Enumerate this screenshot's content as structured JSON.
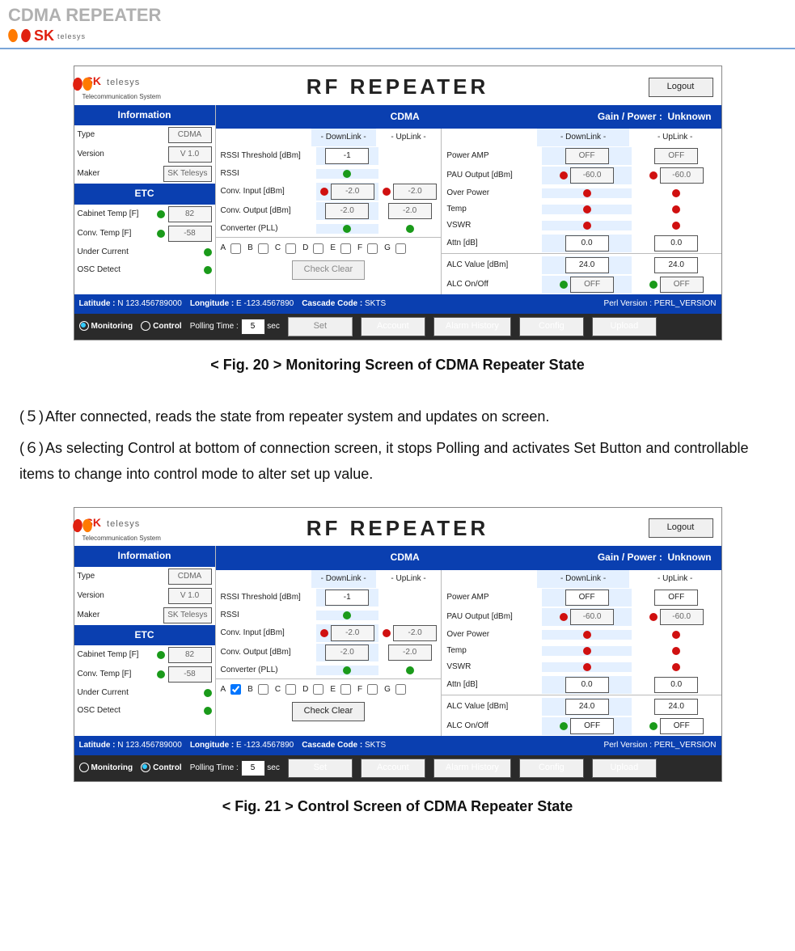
{
  "page_header": "CDMA REPEATER",
  "brand": {
    "name": "SK",
    "sub": "telesys",
    "tagline": "Telecommunication System"
  },
  "caption1": "< Fig. 20 > Monitoring Screen of CDMA Repeater State",
  "caption2": "< Fig. 21 > Control Screen of CDMA Repeater State",
  "para5_num": "(５)",
  "para5": "After connected, reads the state from repeater system and updates on screen.",
  "para6_num": "(６)",
  "para6": "As selecting Control at bottom of connection screen, it stops Polling and activates Set Button and controllable items to change into control mode to alter set up value.",
  "shot": {
    "title": "RF REPEATER",
    "logout": "Logout",
    "info_header": "Information",
    "cdma_header": "CDMA",
    "gain_label": "Gain / Power :",
    "gain_value": "Unknown",
    "dl": "- DownLink -",
    "ul": "- UpLink -",
    "info_rows": {
      "type_lbl": "Type",
      "type_val": "CDMA",
      "version_lbl": "Version",
      "version_val": "V 1.0",
      "maker_lbl": "Maker",
      "maker_val": "SK Telesys"
    },
    "etc_header": "ETC",
    "etc": {
      "r1_lbl": "Cabinet Temp [F]",
      "r1_val": "82",
      "r2_lbl": "Conv. Temp [F]",
      "r2_val": "-58",
      "r3_lbl": "Under Current",
      "r4_lbl": "OSC Detect"
    },
    "left_params": {
      "p1": "RSSI Threshold [dBm]",
      "p1_dl": "-1",
      "p2": "RSSI",
      "p3": "Conv. Input [dBm]",
      "p3_dl": "-2.0",
      "p3_ul": "-2.0",
      "p4": "Conv. Output [dBm]",
      "p4_dl": "-2.0",
      "p4_ul": "-2.0",
      "p5": "Converter (PLL)"
    },
    "right_params": {
      "r1": "Power AMP",
      "r1_dl": "OFF",
      "r1_ul": "OFF",
      "r2": "PAU Output [dBm]",
      "r2_dl": "-60.0",
      "r2_ul": "-60.0",
      "r3": "Over Power",
      "r4": "Temp",
      "r5": "VSWR",
      "r6": "Attn [dB]",
      "r6_dl": "0.0",
      "r6_ul": "0.0",
      "r7": "ALC Value [dBm]",
      "r7_dl": "24.0",
      "r7_ul": "24.0",
      "r8": "ALC On/Off",
      "r8_dl": "OFF",
      "r8_ul": "OFF"
    },
    "abc": {
      "A": "A",
      "B": "B",
      "C": "C",
      "D": "D",
      "E": "E",
      "F": "F",
      "G": "G"
    },
    "check_clear": "Check Clear",
    "status": {
      "lat_lbl": "Latitude :",
      "lat_val": "N 123.456789000",
      "lon_lbl": "Longitude :",
      "lon_val": "E -123.4567890",
      "casc_lbl": "Cascade Code :",
      "casc_val": "SKTS",
      "perl_lbl": "Perl Version :",
      "perl_val": "PERL_VERSION"
    },
    "footer": {
      "monitoring": "Monitoring",
      "control": "Control",
      "poll_lbl": "Polling Time :",
      "poll_val": "5",
      "poll_unit": "sec",
      "set": "Set",
      "account": "Account",
      "alarm": "Alarm History",
      "config": "Config",
      "upload": "Upload"
    }
  }
}
